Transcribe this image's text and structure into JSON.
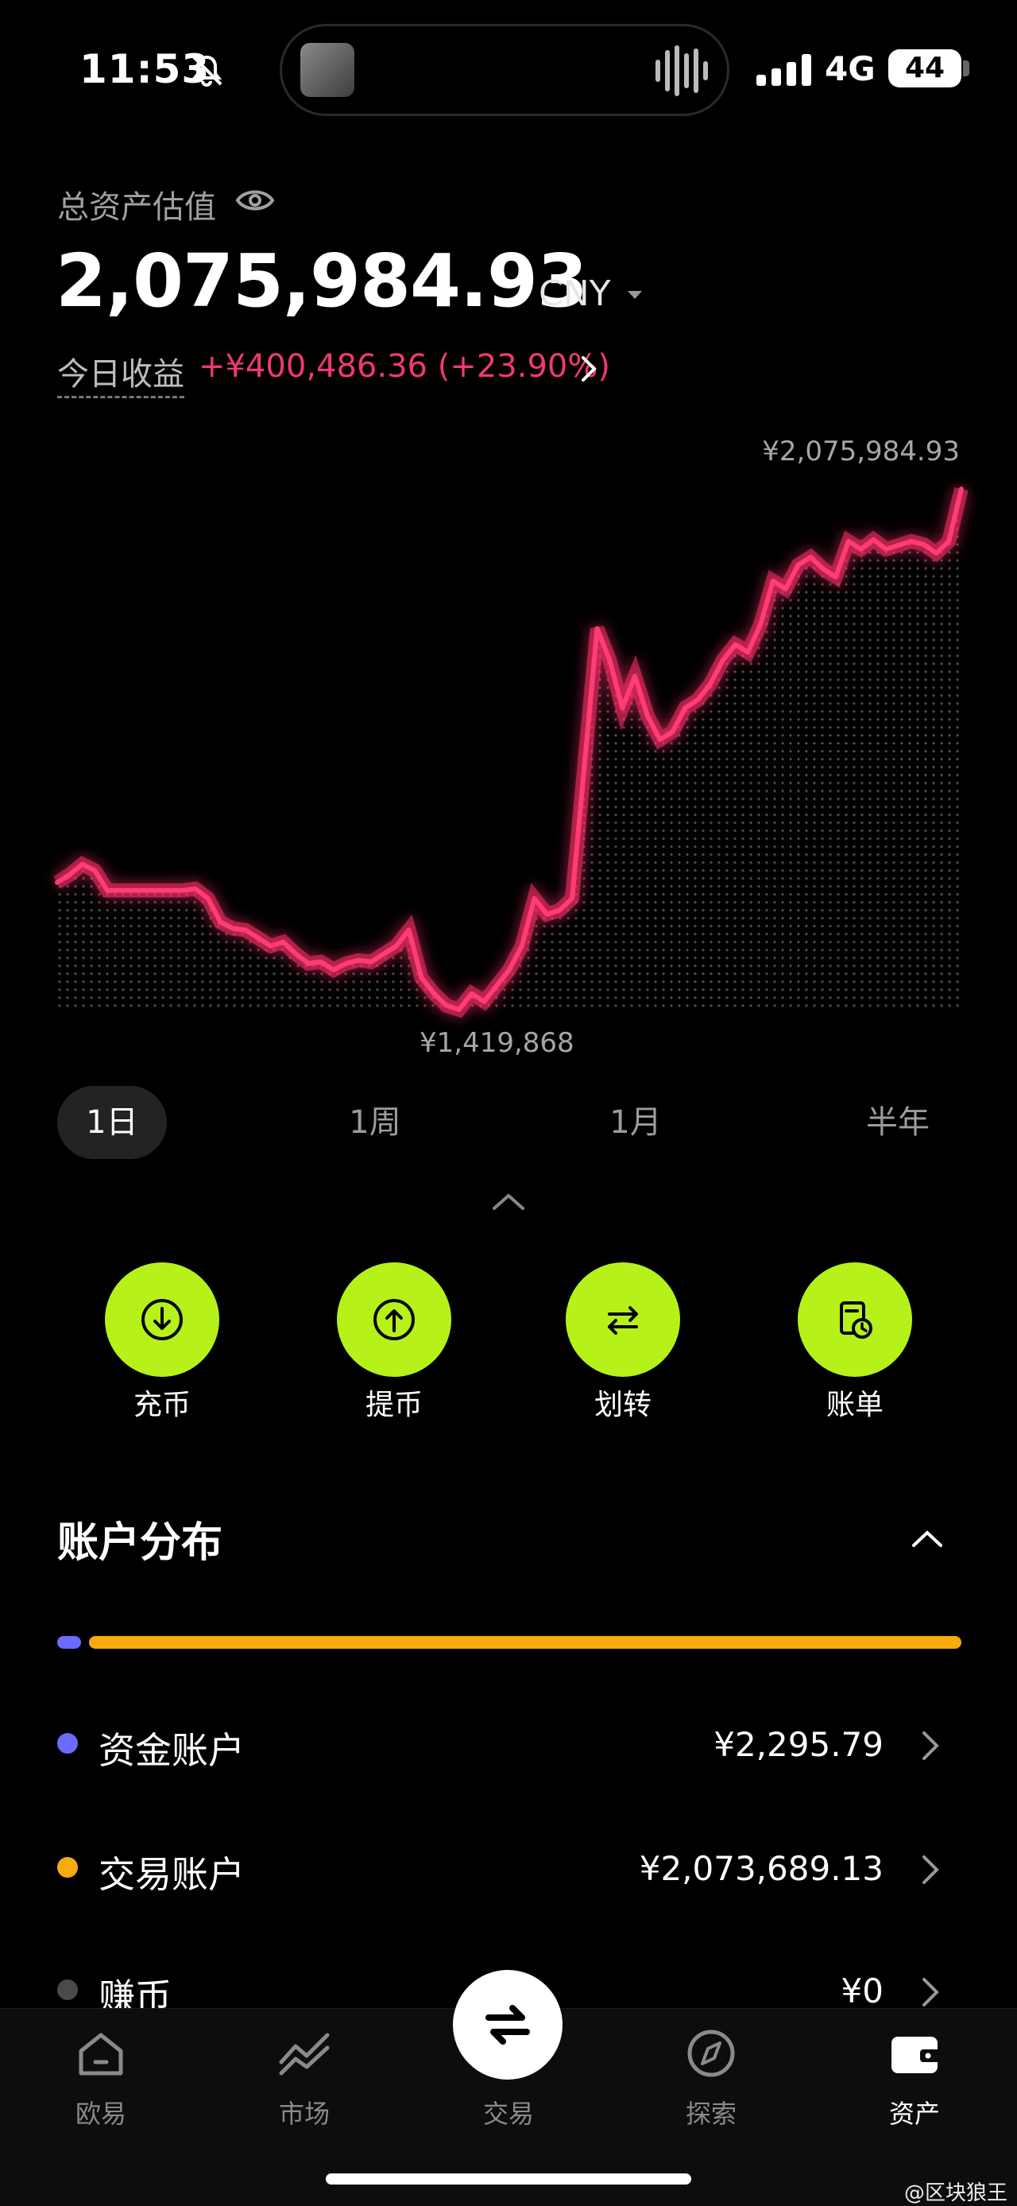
{
  "status_bar": {
    "time": "11:53",
    "network": "4G",
    "battery": "44"
  },
  "header": {
    "total_label": "总资产估值",
    "total_value": "2,075,984.93",
    "currency": "CNY",
    "pnl_label": "今日收益",
    "pnl_value": "+¥400,486.36 (+23.90%)"
  },
  "colors": {
    "accent_green": "#b6f21a",
    "pnl_red": "#ee3a6e",
    "chart_line": "#ff3d74",
    "fund_dot": "#6b6bff",
    "trade_dot": "#f8ab0e",
    "earn_dot": "#4a4a4a"
  },
  "chart_data": {
    "type": "line",
    "max_label": "¥2,075,984.93",
    "min_label": "¥1,419,868",
    "ylim": [
      1419868,
      2075984.93
    ],
    "values": [
      1580000,
      1590000,
      1603000,
      1595000,
      1570000,
      1570000,
      1570000,
      1570000,
      1570000,
      1570000,
      1570000,
      1572000,
      1560000,
      1530000,
      1522000,
      1520000,
      1510000,
      1500000,
      1505000,
      1490000,
      1478000,
      1480000,
      1470000,
      1478000,
      1482000,
      1480000,
      1490000,
      1500000,
      1520000,
      1460000,
      1440000,
      1425000,
      1419868,
      1440000,
      1430000,
      1450000,
      1470000,
      1500000,
      1560000,
      1540000,
      1545000,
      1560000,
      1730000,
      1900000,
      1860000,
      1800000,
      1840000,
      1790000,
      1760000,
      1770000,
      1800000,
      1810000,
      1830000,
      1860000,
      1880000,
      1870000,
      1905000,
      1960000,
      1950000,
      1980000,
      1990000,
      1975000,
      1965000,
      2010000,
      2000000,
      2012000,
      2000000,
      2005000,
      2010000,
      2006000,
      1995000,
      2010000,
      2075984.93
    ]
  },
  "periods": [
    "1日",
    "1周",
    "1月",
    "半年"
  ],
  "actions": [
    {
      "label": "充币",
      "icon": "deposit-icon"
    },
    {
      "label": "提币",
      "icon": "withdraw-icon"
    },
    {
      "label": "划转",
      "icon": "transfer-icon"
    },
    {
      "label": "账单",
      "icon": "bill-icon"
    }
  ],
  "distribution": {
    "title": "账户分布",
    "accounts": [
      {
        "name": "资金账户",
        "value": "¥2,295.79"
      },
      {
        "name": "交易账户",
        "value": "¥2,073,689.13"
      },
      {
        "name": "赚币",
        "value": "¥0"
      }
    ]
  },
  "tabbar": {
    "items": [
      {
        "label": "欧易",
        "icon": "home-icon"
      },
      {
        "label": "市场",
        "icon": "market-chart-icon"
      },
      {
        "label": "交易",
        "icon": "swap-icon"
      },
      {
        "label": "探索",
        "icon": "compass-icon"
      },
      {
        "label": "资产",
        "icon": "wallet-icon"
      }
    ]
  },
  "watermark": "@区块狼王"
}
